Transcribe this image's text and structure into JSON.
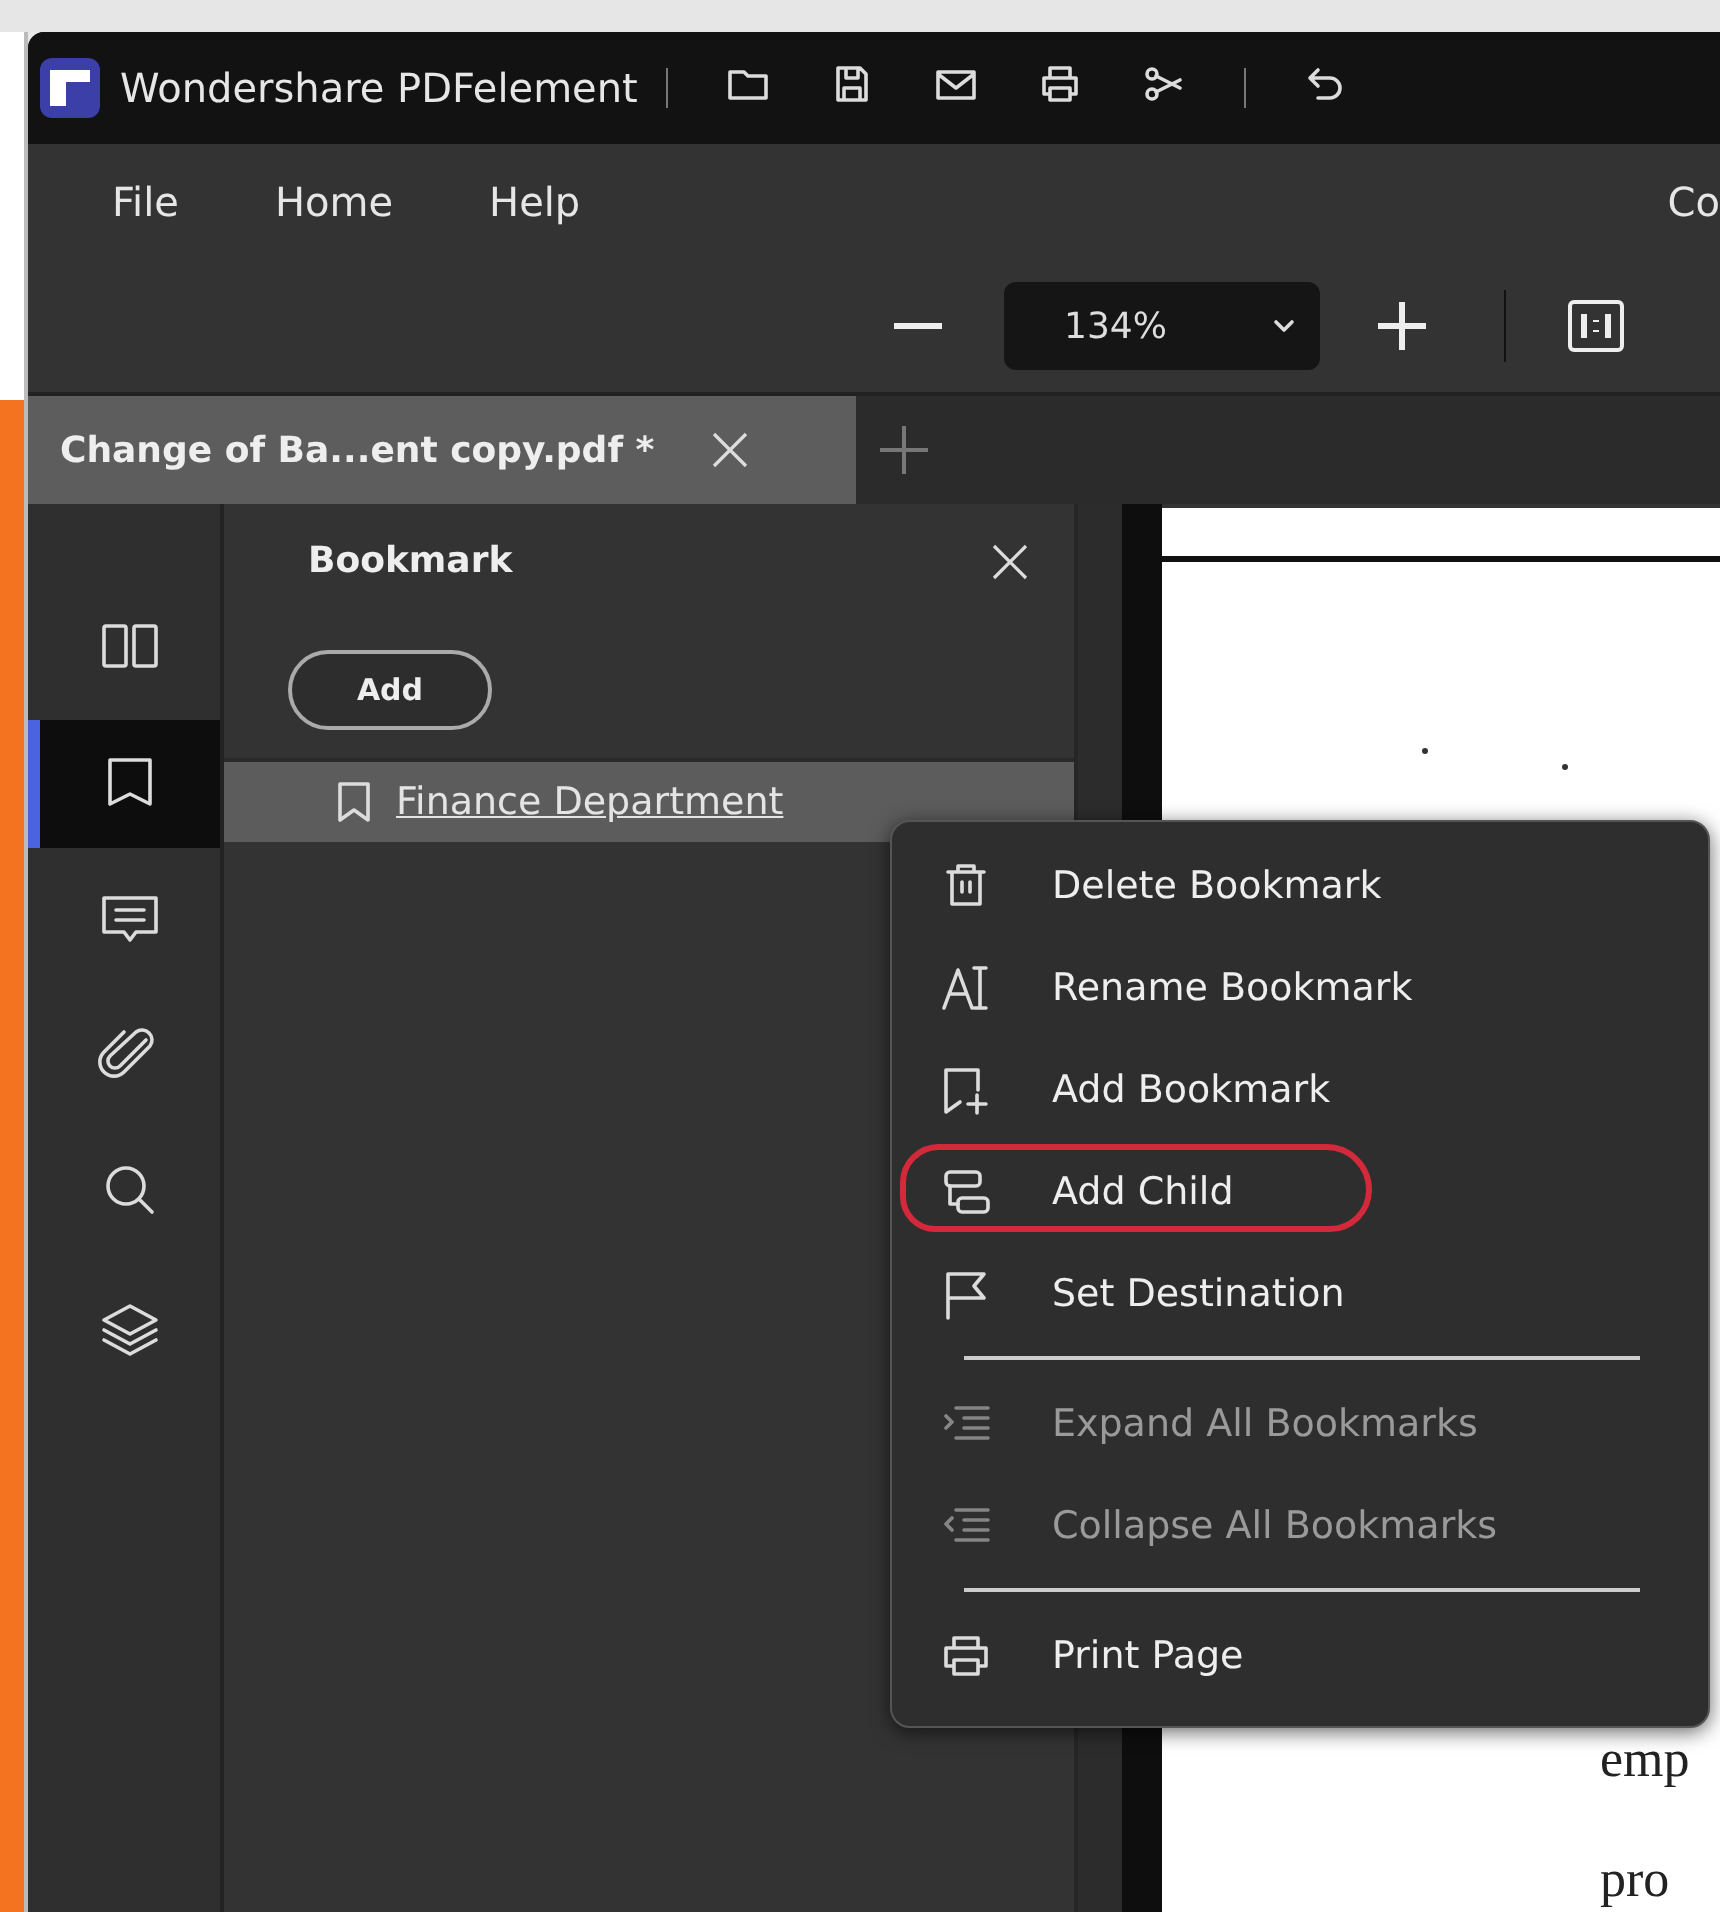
{
  "window": {
    "title": "Wondershare PDFelement"
  },
  "menubar": [
    {
      "label": "File"
    },
    {
      "label": "Home"
    },
    {
      "label": "Help"
    },
    {
      "label": "Co"
    }
  ],
  "zoom": {
    "value": "134%"
  },
  "tabs": [
    {
      "title": "Change of Ba...ent copy.pdf *",
      "selected": true
    }
  ],
  "rail": [
    {
      "selected": false
    },
    {
      "selected": true
    },
    {
      "selected": false
    },
    {
      "selected": false
    },
    {
      "selected": false
    },
    {
      "selected": false
    }
  ],
  "bookmark_panel": {
    "title": "Bookmark",
    "add_button": "Add",
    "bookmarks": [
      {
        "label": "Finance Department",
        "selected": true
      }
    ]
  },
  "context_menu": [
    {
      "kind": "item",
      "label": "Delete Bookmark",
      "disabled": false,
      "circled": false
    },
    {
      "kind": "item",
      "label": "Rename Bookmark",
      "disabled": false,
      "circled": false
    },
    {
      "kind": "item",
      "label": "Add Bookmark",
      "disabled": false,
      "circled": false
    },
    {
      "kind": "item",
      "label": "Add Child",
      "disabled": false,
      "circled": true
    },
    {
      "kind": "item",
      "label": "Set Destination",
      "disabled": false,
      "circled": false
    },
    {
      "kind": "separator"
    },
    {
      "kind": "item",
      "label": "Expand All Bookmarks",
      "disabled": true,
      "circled": false
    },
    {
      "kind": "item",
      "label": "Collapse All Bookmarks",
      "disabled": true,
      "circled": false
    },
    {
      "kind": "separator"
    },
    {
      "kind": "item",
      "label": "Print Page",
      "disabled": false,
      "circled": false
    }
  ],
  "document": {
    "lines": [
      "emp",
      "pro"
    ]
  }
}
